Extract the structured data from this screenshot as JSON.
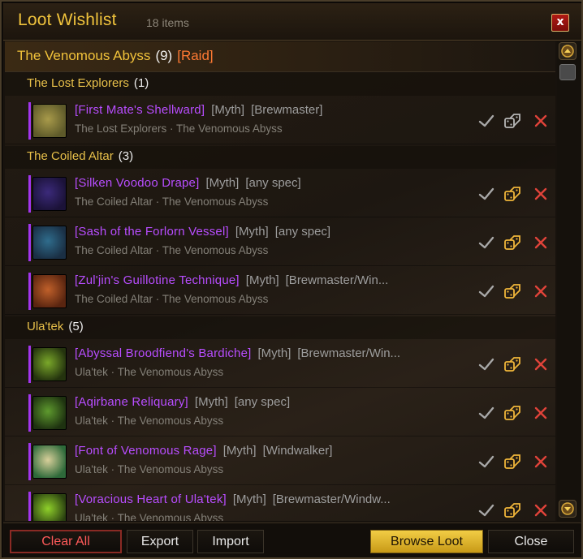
{
  "window": {
    "title": "Loot Wishlist",
    "item_count": "18 items",
    "close_glyph": "x"
  },
  "raid": {
    "name": "The Venomous Abyss",
    "count": "(9)",
    "tag": "[Raid]"
  },
  "groups": [
    {
      "boss": "The Lost Explorers",
      "count": "(1)",
      "items": [
        {
          "name": "[First Mate's Shellward]",
          "difficulty": "[Myth]",
          "spec": "[Brewmaster]",
          "source": "The Lost Explorers · The Venomous Abyss",
          "icon": "shell-shield-icon",
          "colors": [
            "#a89a4a",
            "#5e5a2a"
          ]
        }
      ]
    },
    {
      "boss": "The Coiled Altar",
      "count": "(3)",
      "items": [
        {
          "name": "[Silken Voodoo Drape]",
          "difficulty": "[Myth]",
          "spec": "[any spec]",
          "source": "The Coiled Altar · The Venomous Abyss",
          "icon": "cloak-icon",
          "colors": [
            "#3b2a7a",
            "#1b1238"
          ]
        },
        {
          "name": "[Sash of the Forlorn Vessel]",
          "difficulty": "[Myth]",
          "spec": "[any spec]",
          "source": "The Coiled Altar · The Venomous Abyss",
          "icon": "belt-icon",
          "colors": [
            "#2f6c8c",
            "#1a2f44"
          ]
        },
        {
          "name": "[Zul'jin's Guillotine Technique]",
          "difficulty": "[Myth]",
          "spec": "[Brewmaster/Win...",
          "source": "The Coiled Altar · The Venomous Abyss",
          "icon": "axe-scroll-icon",
          "colors": [
            "#c0602a",
            "#5a2510"
          ]
        }
      ]
    },
    {
      "boss": "Ula'tek",
      "count": "(5)",
      "items": [
        {
          "name": "[Abyssal Broodfiend's Bardiche]",
          "difficulty": "[Myth]",
          "spec": "[Brewmaster/Win...",
          "source": "Ula'tek · The Venomous Abyss",
          "icon": "polearm-icon",
          "colors": [
            "#7aa82a",
            "#24330e"
          ]
        },
        {
          "name": "[Aqirbane Reliquary]",
          "difficulty": "[Myth]",
          "spec": "[any spec]",
          "source": "Ula'tek · The Venomous Abyss",
          "icon": "relic-icon",
          "colors": [
            "#5e9a2e",
            "#1e3210"
          ]
        },
        {
          "name": "[Font of Venomous Rage]",
          "difficulty": "[Myth]",
          "spec": "[Windwalker]",
          "source": "Ula'tek · The Venomous Abyss",
          "icon": "serpent-trinket-icon",
          "colors": [
            "#d8cf9a",
            "#2e6a3a"
          ]
        },
        {
          "name": "[Voracious Heart of Ula'tek]",
          "difficulty": "[Myth]",
          "spec": "[Brewmaster/Windw...",
          "source": "Ula'tek · The Venomous Abyss",
          "icon": "heart-icon",
          "colors": [
            "#8fd02a",
            "#2a4010"
          ]
        }
      ]
    }
  ],
  "footer": {
    "clear_all": "Clear All",
    "export": "Export",
    "import": "Import",
    "browse_loot": "Browse Loot",
    "close": "Close"
  },
  "colors": {
    "title_gold": "#f0c33c",
    "epic_purple": "#b84dff",
    "raid_tag": "#ff7a33",
    "delete_red": "#e0433a",
    "action_gold": "#f0b63a"
  }
}
